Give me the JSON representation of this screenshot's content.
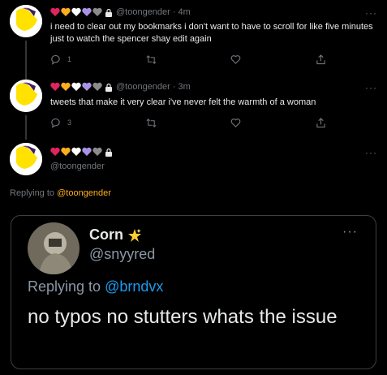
{
  "tweets": [
    {
      "handle": "@toongender",
      "time": "4m",
      "text": "i need to clear out my bookmarks i don't want to have to scroll for like five minutes just to watch the spencer shay edit again",
      "reply_count": "1"
    },
    {
      "handle": "@toongender",
      "time": "3m",
      "text": "tweets that make it very clear i've never felt the warmth of a woman",
      "reply_count": "3"
    }
  ],
  "compose": {
    "handle": "@toongender",
    "replying_prefix": "Replying to",
    "replying_mention": "@toongender"
  },
  "quoted": {
    "name": "Corn",
    "handle": "@snyyred",
    "replying_prefix": "Replying to",
    "replying_mention": "@brndvx",
    "text": "no typos no stutters whats the issue"
  },
  "more_glyph": "···",
  "heart_colors": [
    "#e0245e",
    "#ffad1f",
    "#ffffff",
    "#ab91e6",
    "#8b8b8b"
  ],
  "accent_color": "#ffad1f",
  "link_color": "#1d9bf0",
  "icons": [
    "reply-icon",
    "retweet-icon",
    "like-icon",
    "share-icon",
    "lock-icon",
    "star-emoji-icon"
  ]
}
